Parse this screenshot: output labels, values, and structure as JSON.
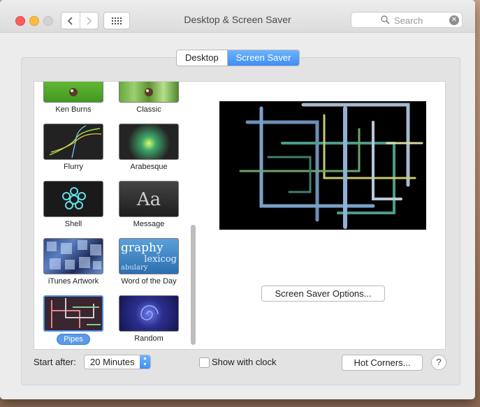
{
  "window": {
    "title": "Desktop & Screen Saver",
    "search_placeholder": "Search"
  },
  "tabs": [
    {
      "label": "Desktop",
      "selected": false
    },
    {
      "label": "Screen Saver",
      "selected": true
    }
  ],
  "screensavers": [
    {
      "label": "Ken Burns",
      "selected": false
    },
    {
      "label": "Classic",
      "selected": false
    },
    {
      "label": "Flurry",
      "selected": false
    },
    {
      "label": "Arabesque",
      "selected": false
    },
    {
      "label": "Shell",
      "selected": false
    },
    {
      "label": "Message",
      "selected": false
    },
    {
      "label": "iTunes Artwork",
      "selected": false
    },
    {
      "label": "Word of the Day",
      "selected": false
    },
    {
      "label": "Pipes",
      "selected": true
    },
    {
      "label": "Random",
      "selected": false
    }
  ],
  "thumb_text": {
    "message": "Aa",
    "word_line1": "graphy",
    "word_line2": "lexicog",
    "word_line3": "abulary"
  },
  "preview": {
    "options_button": "Screen Saver Options..."
  },
  "footer": {
    "start_after_label": "Start after:",
    "start_after_value": "20 Minutes",
    "show_clock_label": "Show with clock",
    "show_clock_checked": false,
    "hot_corners_button": "Hot Corners...",
    "help_button": "?"
  },
  "colors": {
    "accent": "#3f8ef4",
    "selection": "#5b9ae6"
  }
}
